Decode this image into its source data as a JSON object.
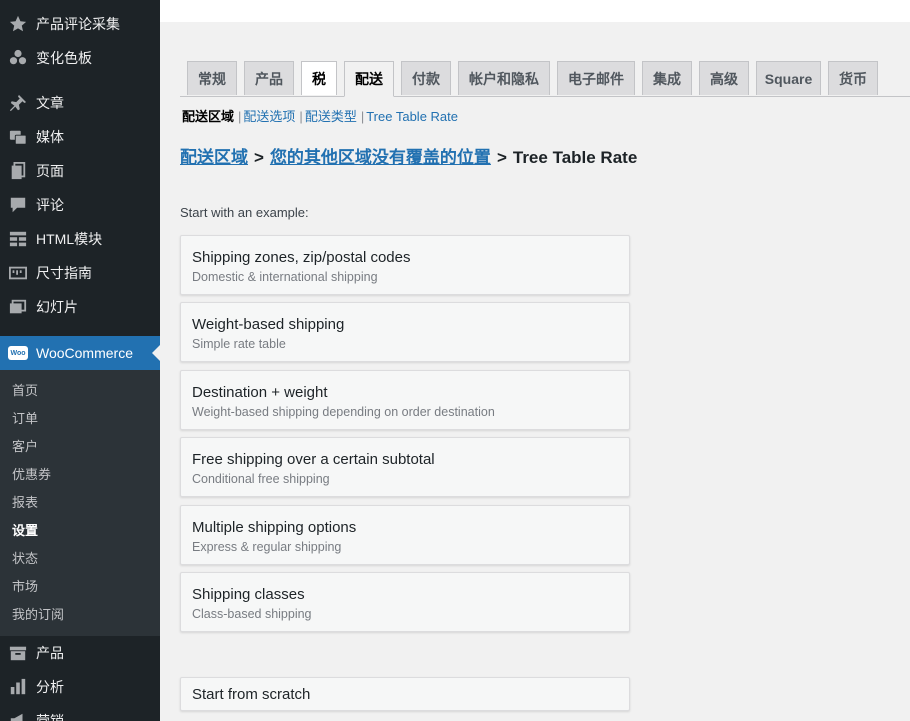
{
  "sidebar": {
    "top_items": [
      {
        "label": "产品评论采集",
        "icon": "star-icon"
      },
      {
        "label": "变化色板",
        "icon": "swatches-icon"
      },
      {
        "label": "文章",
        "icon": "pin-icon"
      },
      {
        "label": "媒体",
        "icon": "media-icon"
      },
      {
        "label": "页面",
        "icon": "page-icon"
      },
      {
        "label": "评论",
        "icon": "comment-icon"
      },
      {
        "label": "HTML模块",
        "icon": "html-block-icon"
      },
      {
        "label": "尺寸指南",
        "icon": "ruler-icon"
      },
      {
        "label": "幻灯片",
        "icon": "slides-icon"
      }
    ],
    "woocommerce": {
      "label": "WooCommerce",
      "logo": "Woo"
    },
    "submenu": [
      {
        "label": "首页"
      },
      {
        "label": "订单"
      },
      {
        "label": "客户"
      },
      {
        "label": "优惠券"
      },
      {
        "label": "报表"
      },
      {
        "label": "设置"
      },
      {
        "label": "状态"
      },
      {
        "label": "市场"
      },
      {
        "label": "我的订阅"
      }
    ],
    "bottom_items": [
      {
        "label": "产品",
        "icon": "archive-icon"
      },
      {
        "label": "分析",
        "icon": "bar-chart-icon"
      },
      {
        "label": "营销",
        "icon": "megaphone-icon"
      }
    ]
  },
  "tabs": [
    {
      "label": "常规"
    },
    {
      "label": "产品"
    },
    {
      "label": "税"
    },
    {
      "label": "配送"
    },
    {
      "label": "付款"
    },
    {
      "label": "帐户和隐私"
    },
    {
      "label": "电子邮件"
    },
    {
      "label": "集成"
    },
    {
      "label": "高级"
    },
    {
      "label": "Square"
    },
    {
      "label": "货币"
    }
  ],
  "subsubsub": {
    "current": "配送区域",
    "links": [
      "配送选项",
      "配送类型",
      "Tree Table Rate"
    ],
    "separator": "|"
  },
  "breadcrumb": {
    "link1": "配送区域",
    "link2": "您的其他区域没有覆盖的位置",
    "separator": ">",
    "current": "Tree Table Rate"
  },
  "examples_label": "Start with an example:",
  "examples": [
    {
      "title": "Shipping zones, zip/postal codes",
      "desc": "Domestic & international shipping"
    },
    {
      "title": "Weight-based shipping",
      "desc": "Simple rate table"
    },
    {
      "title": "Destination + weight",
      "desc": "Weight-based shipping depending on order destination"
    },
    {
      "title": "Free shipping over a certain subtotal",
      "desc": "Conditional free shipping"
    },
    {
      "title": "Multiple shipping options",
      "desc": "Express & regular shipping"
    },
    {
      "title": "Shipping classes",
      "desc": "Class-based shipping"
    }
  ],
  "scratch": {
    "title": "Start from scratch"
  },
  "colors": {
    "sidebar_bg": "#1d2327",
    "submenu_bg": "#2c3338",
    "accent": "#2271b1",
    "page_bg": "#f1f1f1"
  }
}
